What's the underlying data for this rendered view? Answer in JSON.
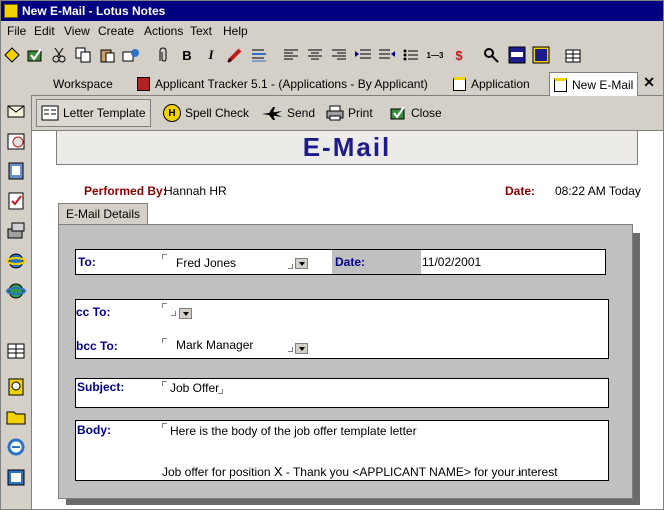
{
  "window": {
    "title": "New E-Mail - Lotus Notes"
  },
  "menu": [
    "File",
    "Edit",
    "View",
    "Create",
    "Actions",
    "Text",
    "Help"
  ],
  "toolbar": {
    "bold": "B",
    "italic": "I",
    "num_symbol": "1—3",
    "spell_symbol": "$"
  },
  "tabs": [
    "Workspace",
    "Applicant Tracker 5.1 - (Applications - By Applicant)",
    "Application",
    "New E-Mail"
  ],
  "tab_close": "✕",
  "actions": [
    "Letter Template",
    "Spell Check",
    "Send",
    "Print",
    "Close"
  ],
  "spell_icon_letter": "H",
  "form": {
    "banner": "E-Mail",
    "performed_by_label": "Performed By:",
    "performed_by": "Hannah HR",
    "date_label": "Date:",
    "date_value": "08:22 AM Today",
    "tab_label": "E-Mail Details",
    "to_label": "To:",
    "to_value": "Fred Jones",
    "date2_label": "Date:",
    "date2_value": "11/02/2001",
    "cc_label": "cc To:",
    "cc_value": "",
    "bcc_label": "bcc To:",
    "bcc_value": "Mark Manager",
    "subject_label": "Subject:",
    "subject_value": "Job Offer",
    "body_label": "Body:",
    "body_line1": "Here is the body of the job offer template letter",
    "body_line2": "Job offer for position",
    "body_x": "X",
    "body_line2b": " - Thank you <APPLICANT NAME> for your interest"
  }
}
